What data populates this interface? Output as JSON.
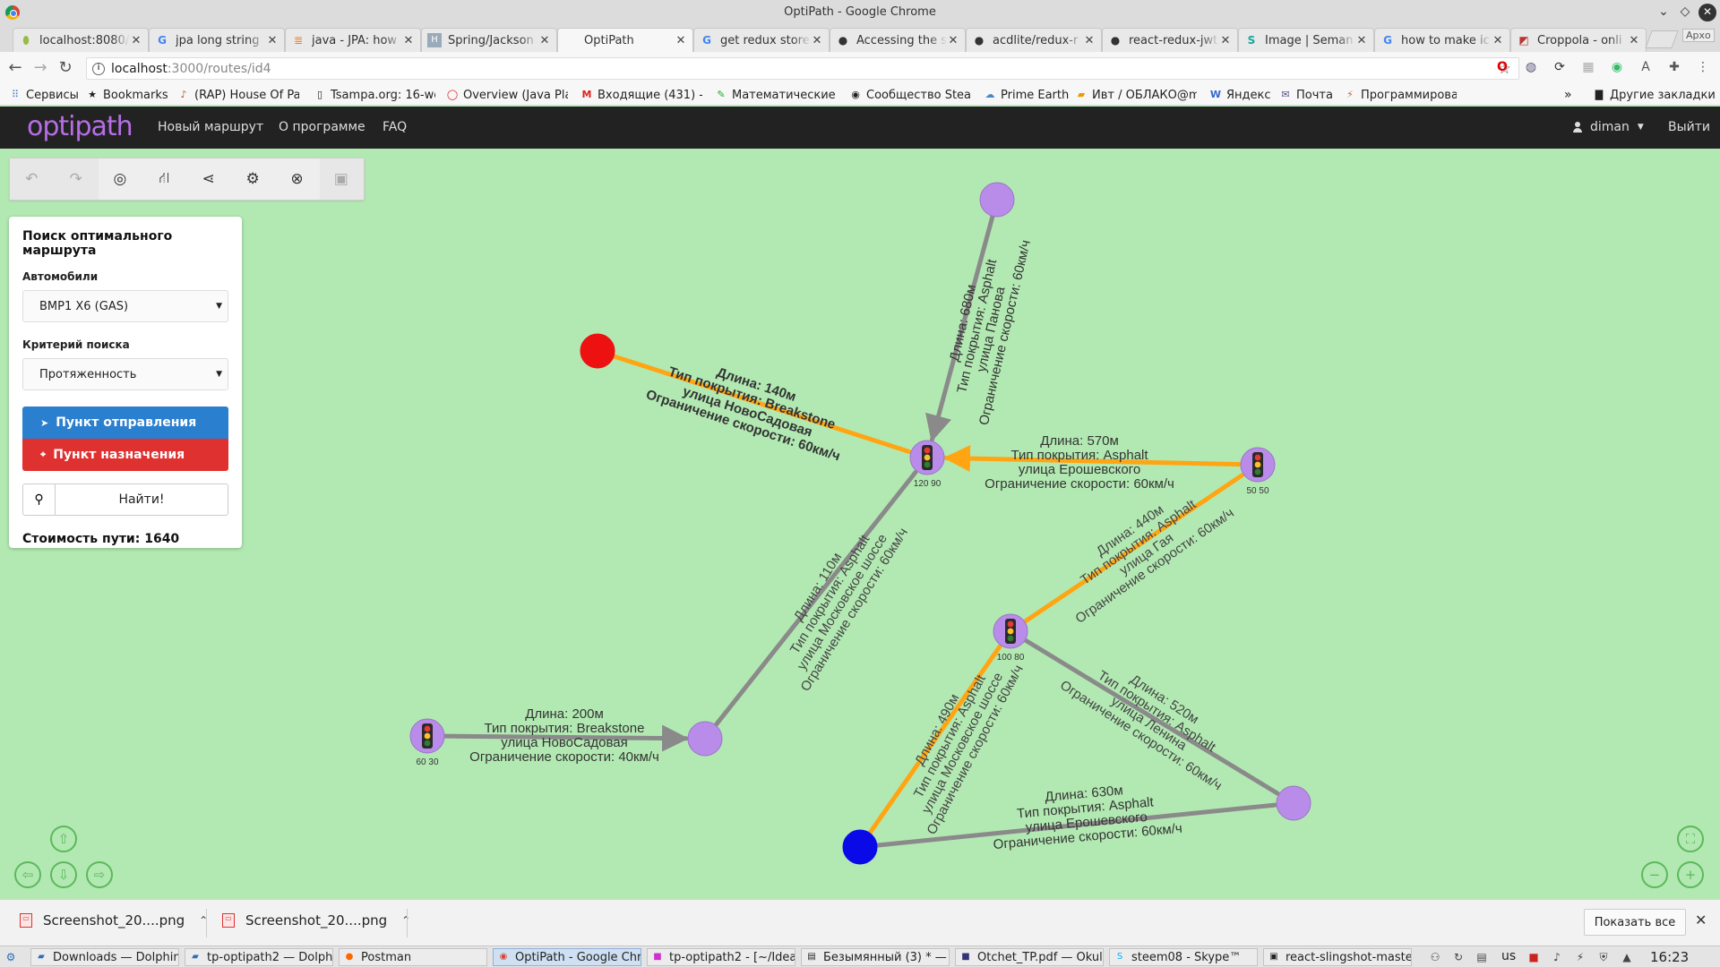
{
  "window": {
    "title": "OptiPath - Google Chrome"
  },
  "tabs": [
    {
      "label": "localhost:8080/",
      "icon": "bracket-icon"
    },
    {
      "label": "jpa long string",
      "icon": "google-icon"
    },
    {
      "label": "java - JPA: how",
      "icon": "stackoverflow-icon"
    },
    {
      "label": "Spring/Jackson",
      "icon": "h-icon"
    },
    {
      "label": "OptiPath",
      "icon": "blank-page-icon",
      "active": true
    },
    {
      "label": "get redux store",
      "icon": "google-icon"
    },
    {
      "label": "Accessing the s",
      "icon": "github-icon"
    },
    {
      "label": "acdlite/redux-r",
      "icon": "github-icon"
    },
    {
      "label": "react-redux-jwt",
      "icon": "github-icon"
    },
    {
      "label": "Image | Seman",
      "icon": "s-icon"
    },
    {
      "label": "how to make ic",
      "icon": "google-icon"
    },
    {
      "label": "Croppola - onli",
      "icon": "croppola-icon"
    }
  ],
  "profile_label": "Архо",
  "address": {
    "host": "localhost",
    "path": ":3000/routes/id4"
  },
  "bookmarks": [
    {
      "label": "Сервисы",
      "icon": "apps-grid-icon"
    },
    {
      "label": "Bookmarks",
      "icon": "star-icon"
    },
    {
      "label": "(RAP) House Of Pain",
      "icon": "rap-icon"
    },
    {
      "label": "Tsampa.org: 16-week",
      "icon": "page-icon"
    },
    {
      "label": "Overview (Java Platf",
      "icon": "oracle-icon"
    },
    {
      "label": "Входящие (431) - el",
      "icon": "gmail-icon"
    },
    {
      "label": "Математические с",
      "icon": "leaf-icon"
    },
    {
      "label": "Сообщество Steam",
      "icon": "steam-icon"
    },
    {
      "label": "Prime Earth",
      "icon": "cloud-icon"
    },
    {
      "label": "Ивт / ОБЛАКО@ma",
      "icon": "cloud-mail-icon"
    },
    {
      "label": "Яндекс",
      "icon": "w-icon"
    },
    {
      "label": "Почта",
      "icon": "mail-icon"
    },
    {
      "label": "Программирован",
      "icon": "code-icon"
    }
  ],
  "other_bookmarks": "Другие закладки",
  "app": {
    "logo": "optipath",
    "nav": [
      "Новый маршрут",
      "О программе",
      "FAQ"
    ],
    "user": "diman",
    "logout": "Выйти"
  },
  "panel": {
    "title": "Поиск оптимального маршрута",
    "cars_label": "Автомобили",
    "car_value": "BMP1 X6 (GAS)",
    "criterion_label": "Критерий поиска",
    "criterion_value": "Протяженность",
    "origin_button": "Пункт отправления",
    "destination_button": "Пункт назначения",
    "find_button": "Найти!",
    "cost_text": "Стоимость пути: 1640"
  },
  "graph": {
    "colors": {
      "node": "#b88ce8",
      "origin": "#ee1111",
      "destination": "#0a0ae8",
      "route": "#ffa514",
      "edge": "#8a8a8a"
    },
    "lights": [
      {
        "label": "120 90"
      },
      {
        "label": "50 50"
      },
      {
        "label": "100 80"
      },
      {
        "label": "60 30"
      }
    ],
    "edges": [
      {
        "lines": [
          "Длина: 680м",
          "Тип покрытия: Asphalt",
          "улица Панова",
          "Ограничение скорости: 60км/ч"
        ]
      },
      {
        "lines": [
          "Длина: 140м",
          "Тип покрытия: Breakstone",
          "улица НовоСадовая",
          "Ограничение скорости: 60км/ч"
        ]
      },
      {
        "lines": [
          "Длина: 570м",
          "Тип покрытия: Asphalt",
          "улица Ерошевского",
          "Ограничение скорости: 60км/ч"
        ]
      },
      {
        "lines": [
          "Длина: 110м",
          "Тип покрытия: Asphalt",
          "улица Московское шоссе",
          "Ограничение скорости: 60км/ч"
        ]
      },
      {
        "lines": [
          "Длина: 440м",
          "Тип покрытия: Asphalt",
          "улица Гая",
          "Ограничение скорости: 60км/ч"
        ]
      },
      {
        "lines": [
          "Длина: 200м",
          "Тип покрытия: Breakstone",
          "улица НовоСадовая",
          "Ограничение скорости: 40км/ч"
        ]
      },
      {
        "lines": [
          "Длина: 490м",
          "Тип покрытия: Asphalt",
          "улица Московское шоссе",
          "Ограничение скорости: 60км/ч"
        ]
      },
      {
        "lines": [
          "Длина: 520м",
          "Тип покрытия: Asphalt",
          "улица Ленина",
          "Ограничение скорости: 60км/ч"
        ]
      },
      {
        "lines": [
          "Длина: 630м",
          "Тип покрытия: Asphalt",
          "улица Ерошевского",
          "Ограничение скорости: 60км/ч"
        ]
      }
    ]
  },
  "downloads": {
    "items": [
      "Screenshot_20....png",
      "Screenshot_20....png"
    ],
    "show_all": "Показать все"
  },
  "taskbar": {
    "tasks": [
      {
        "label": "Downloads — Dolphin",
        "icon": "folder-icon"
      },
      {
        "label": "tp-optipath2 — Dolphin",
        "icon": "folder-icon"
      },
      {
        "label": "Postman",
        "icon": "postman-icon"
      },
      {
        "label": "OptiPath - Google Chrome",
        "icon": "chrome-icon",
        "active": true
      },
      {
        "label": "tp-optipath2 - [~/IdeaP",
        "icon": "intellij-icon"
      },
      {
        "label": "Безымянный (3) * — K",
        "icon": "editor-icon"
      },
      {
        "label": "Otchet_TP.pdf — Okular",
        "icon": "okular-icon"
      },
      {
        "label": "steem08 - Skype™",
        "icon": "skype-icon"
      },
      {
        "label": "react-slingshot-master",
        "icon": "terminal-icon"
      }
    ],
    "lang": "us",
    "clock": "16:23"
  }
}
